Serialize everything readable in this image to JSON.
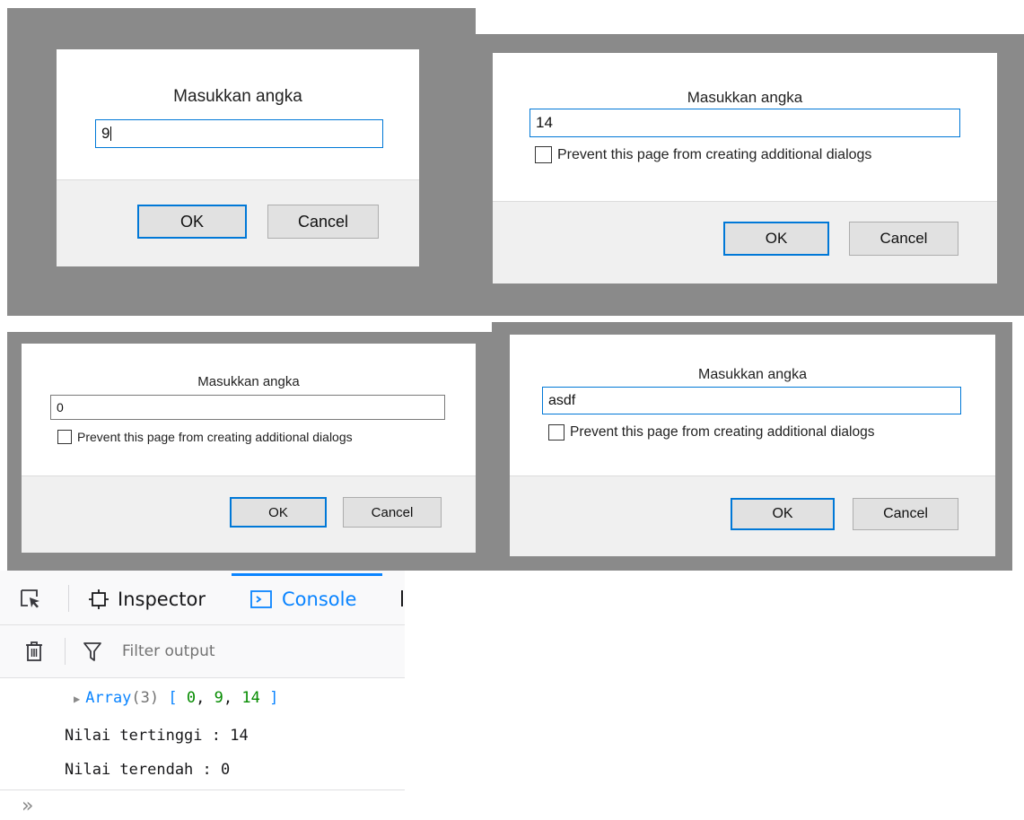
{
  "dialogs": [
    {
      "title": "Masukkan angka",
      "value": "9",
      "ok": "OK",
      "cancel": "Cancel"
    },
    {
      "title": "Masukkan angka",
      "value": "14",
      "checkbox": "Prevent this page from creating additional dialogs",
      "ok": "OK",
      "cancel": "Cancel"
    },
    {
      "title": "Masukkan angka",
      "value": "0",
      "checkbox": "Prevent this page from creating additional dialogs",
      "ok": "OK",
      "cancel": "Cancel"
    },
    {
      "title": "Masukkan angka",
      "value": "asdf",
      "checkbox": "Prevent this page from creating additional dialogs",
      "ok": "OK",
      "cancel": "Cancel"
    }
  ],
  "devtools": {
    "tabs": [
      {
        "label": "Inspector",
        "icon": "inspector-icon"
      },
      {
        "label": "Console",
        "icon": "console-icon",
        "selected": true
      }
    ],
    "filter_placeholder": "Filter output",
    "console": {
      "array_name": "Array",
      "array_count": "(3)",
      "array_open": "[",
      "array_values": [
        "0",
        "9",
        "14"
      ],
      "array_close": "]",
      "line1": "Nilai tertinggi : 14",
      "line2": "Nilai terendah : 0",
      "prompt": "»"
    },
    "colors": {
      "accent": "#0a84ff",
      "number": "#058b00",
      "text": "#18181a"
    }
  }
}
